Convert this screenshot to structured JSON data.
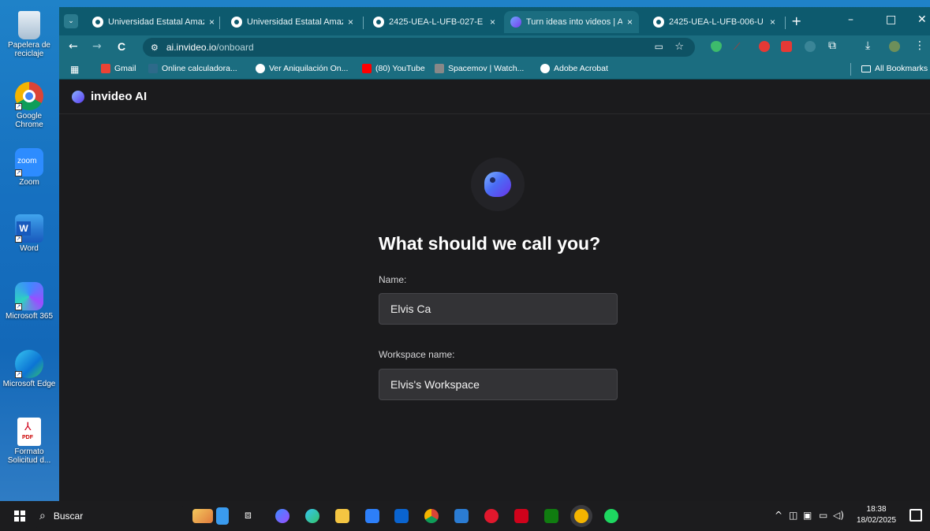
{
  "desktop": {
    "icons": [
      {
        "label": "Papelera de reciclaje",
        "icon": "recycle-bin-icon"
      },
      {
        "label": "Google Chrome",
        "icon": "chrome-icon"
      },
      {
        "label": "Zoom",
        "icon": "zoom-icon",
        "glyph": "zoom"
      },
      {
        "label": "Word",
        "icon": "word-icon",
        "glyph": "W"
      },
      {
        "label": "Microsoft 365",
        "icon": "m365-icon"
      },
      {
        "label": "Microsoft Edge",
        "icon": "edge-icon"
      },
      {
        "label": "Formato Solicitud d...",
        "icon": "pdf-icon",
        "glyph": "PDF"
      }
    ]
  },
  "browser": {
    "tabs": [
      {
        "title": "Universidad Estatal Amaz",
        "close": "×"
      },
      {
        "title": "Universidad Estatal Amaz",
        "close": "×"
      },
      {
        "title": "2425-UEA-L-UFB-027-E",
        "close": "×"
      },
      {
        "title": "Turn ideas into videos | A",
        "close": "×",
        "active": true
      },
      {
        "title": "2425-UEA-L-UFB-006-U",
        "close": "×"
      }
    ],
    "new_tab": "+",
    "window_controls": {
      "minimize": "–",
      "maximize": "□",
      "close": "✕"
    },
    "url": {
      "host": "ai.invideo.io",
      "path": "/onboard"
    },
    "nav": {
      "back": "←",
      "forward": "→",
      "reload": "C"
    },
    "bookmarks": [
      {
        "label": "Gmail",
        "color": "#ea4335"
      },
      {
        "label": "Online calculadora...",
        "color": "#2d6a8a"
      },
      {
        "label": "Ver Aniquilación On...",
        "color": "#ffffff"
      },
      {
        "label": "(80) YouTube",
        "color": "#ff0000"
      },
      {
        "label": "Spacemov | Watch...",
        "color": "#888888"
      },
      {
        "label": "Adobe Acrobat",
        "color": "#ffffff"
      }
    ],
    "all_bookmarks": "All Bookmarks"
  },
  "app": {
    "brand": "invideo AI",
    "heading": "What should we call you?",
    "name_label": "Name:",
    "name_value": "Elvis Ca",
    "workspace_label": "Workspace name:",
    "workspace_value": "Elvis's Workspace",
    "accent": "#6a33e8"
  },
  "taskbar": {
    "search_placeholder": "Buscar",
    "time": "18:38",
    "date": "18/02/2025",
    "tray_caret": "^"
  }
}
